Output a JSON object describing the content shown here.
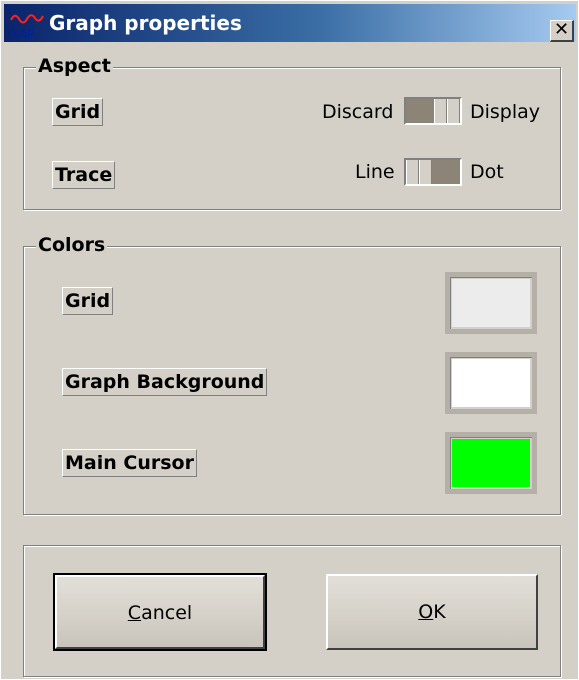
{
  "window": {
    "title": "Graph properties",
    "close_symbol": "✕",
    "app_icon": "xap-logo-icon"
  },
  "aspect": {
    "legend": "Aspect",
    "grid": {
      "label": "Grid",
      "off_text": "Discard",
      "on_text": "Display",
      "state": "Display"
    },
    "trace": {
      "label": "Trace",
      "off_text": "Line",
      "on_text": "Dot",
      "state": "Line"
    }
  },
  "colors": {
    "legend": "Colors",
    "items": [
      {
        "label": "Grid",
        "color": "#ececec"
      },
      {
        "label": "Graph Background",
        "color": "#ffffff"
      },
      {
        "label": "Main Cursor",
        "color": "#00ff00"
      }
    ]
  },
  "buttons": {
    "cancel": {
      "mnemonic": "C",
      "rest": "ancel"
    },
    "ok": {
      "mnemonic": "O",
      "rest": "K"
    }
  }
}
